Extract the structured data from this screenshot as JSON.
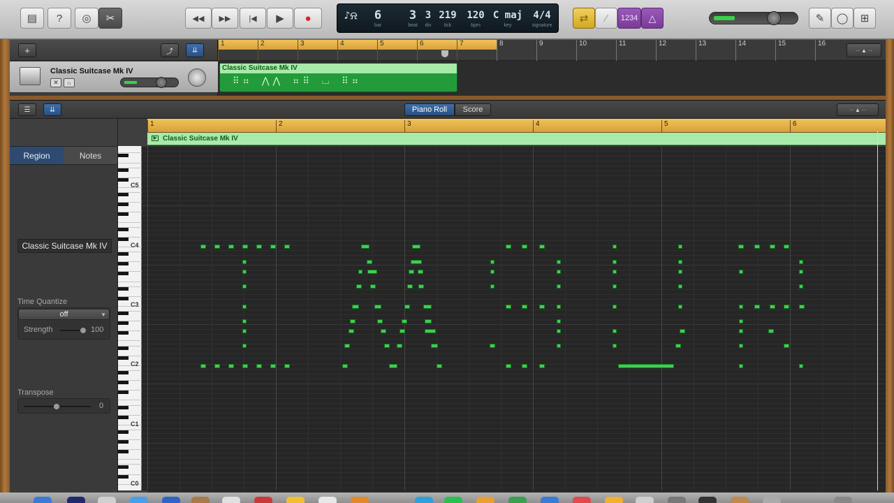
{
  "control_bar": {
    "buttons": [
      {
        "name": "library-button",
        "glyph": "▤"
      },
      {
        "name": "help-button",
        "glyph": "?"
      },
      {
        "name": "smart-controls-button",
        "glyph": "◎"
      },
      {
        "name": "editors-button",
        "glyph": "✂"
      }
    ],
    "transport": [
      {
        "name": "rewind-button",
        "glyph": "◀◀"
      },
      {
        "name": "fast-forward-button",
        "glyph": "▶▶"
      },
      {
        "name": "go-to-beginning-button",
        "glyph": "|◀"
      },
      {
        "name": "play-button",
        "glyph": "▶"
      },
      {
        "name": "record-button",
        "glyph": "●"
      }
    ],
    "lcd": {
      "bar": "6",
      "bar_label": "bar",
      "beat": "3",
      "beat_label": "beat",
      "div": "3",
      "div_label": "div",
      "tick": "219",
      "tick_label": "tick",
      "bpm": "120",
      "bpm_label": "bpm",
      "key": "C maj",
      "key_label": "key",
      "signature": "4/4",
      "signature_label": "signature"
    },
    "right_buttons": [
      {
        "name": "cycle-button",
        "glyph": "⇄"
      },
      {
        "name": "tuner-button",
        "glyph": "⁄"
      },
      {
        "name": "count-in-button",
        "glyph": "1234"
      },
      {
        "name": "metronome-button",
        "glyph": "△"
      }
    ],
    "master_volume_level": 0.7,
    "far_right": [
      {
        "name": "notepad-button",
        "glyph": "✎"
      },
      {
        "name": "apple-loops-button",
        "glyph": "◯"
      },
      {
        "name": "media-browser-button",
        "glyph": "⊞"
      }
    ]
  },
  "tracks": {
    "add_glyph": "+",
    "track_name": "Classic Suitcase Mk IV",
    "region_name": "Classic Suitcase Mk IV",
    "region_pattern": "⠿⠶ ⋀⋀ ⠶⠿ ⌴ ⠿⠶",
    "ruler": [
      "1",
      "2",
      "3",
      "4",
      "5",
      "6",
      "7",
      "8",
      "9",
      "10",
      "11",
      "12",
      "13",
      "14",
      "15",
      "16"
    ]
  },
  "editor": {
    "tabs": [
      "Piano Roll",
      "Score"
    ],
    "inspector": {
      "tab_region": "Region",
      "tab_notes": "Notes",
      "region_name": "Classic Suitcase Mk IV",
      "time_quantize_label": "Time Quantize",
      "time_quantize_value": "off",
      "strength_label": "Strength",
      "strength_value": "100",
      "transpose_label": "Transpose",
      "transpose_value": "0"
    },
    "ruler": [
      "1",
      "2",
      "3",
      "4",
      "5",
      "6"
    ],
    "region_name": "Classic Suitcase Mk IV",
    "key_labels": [
      "C5",
      "C4",
      "C3",
      "C2",
      "C1",
      "C0"
    ]
  },
  "colors": {
    "note_fill": "#44cc55",
    "region_header": "#a7eaaa",
    "ruler_gold": "#f0c35a",
    "lcd_bg": "#1d2a33"
  }
}
